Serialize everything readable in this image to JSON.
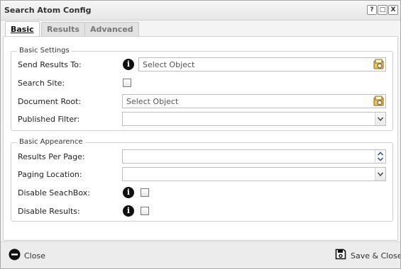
{
  "window": {
    "title": "Search Atom Config",
    "controls": [
      "?",
      "□",
      "X"
    ]
  },
  "tabs": [
    {
      "label": "Basic",
      "active": true
    },
    {
      "label": "Results",
      "active": false
    },
    {
      "label": "Advanced",
      "active": false
    }
  ],
  "basic_settings": {
    "legend": "Basic Settings",
    "send_results_to": {
      "label": "Send Results To:",
      "placeholder": "Select Object"
    },
    "search_site": {
      "label": "Search Site:",
      "checked": false
    },
    "document_root": {
      "label": "Document Root:",
      "placeholder": "Select Object"
    },
    "published_filter": {
      "label": "Published Filter:",
      "value": ""
    }
  },
  "basic_appearance": {
    "legend": "Basic Appearence",
    "results_per_page": {
      "label": "Results Per Page:",
      "value": ""
    },
    "paging_location": {
      "label": "Paging Location:",
      "value": ""
    },
    "disable_searchbox": {
      "label": "Disable SeachBox:",
      "checked": false
    },
    "disable_results": {
      "label": "Disable Results:",
      "checked": false
    }
  },
  "footer": {
    "close_label": "Close",
    "save_close_label": "Save & Close"
  },
  "icons": {
    "info": "info-icon",
    "picker": "object-picker-icon",
    "close": "close-circle-icon",
    "save": "floppy-disk-icon"
  }
}
